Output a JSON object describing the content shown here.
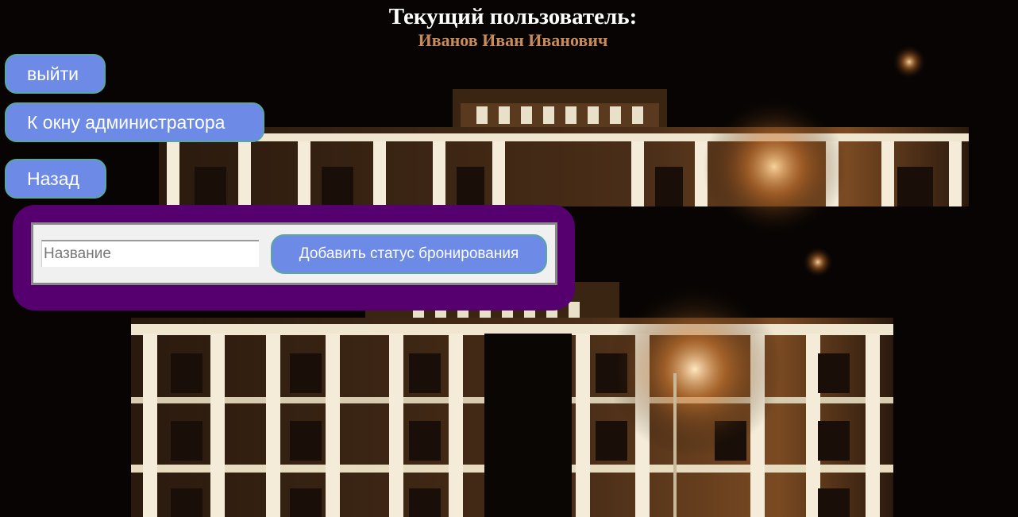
{
  "header": {
    "label": "Текущий пользователь:",
    "user_name": "Иванов Иван Иванович"
  },
  "nav": {
    "logout_label": "выйти",
    "admin_label": "К окну администратора",
    "back_label": "Назад"
  },
  "form": {
    "name_placeholder": "Название",
    "name_value": "",
    "add_label": "Добавить статус бронирования"
  },
  "colors": {
    "button_bg": "#6c8ae6",
    "button_border": "#5aa6a0",
    "panel_bg": "#55006e",
    "user_name": "#c88c5a"
  },
  "icons": {
    "background": "hotel-building-night-photo"
  }
}
